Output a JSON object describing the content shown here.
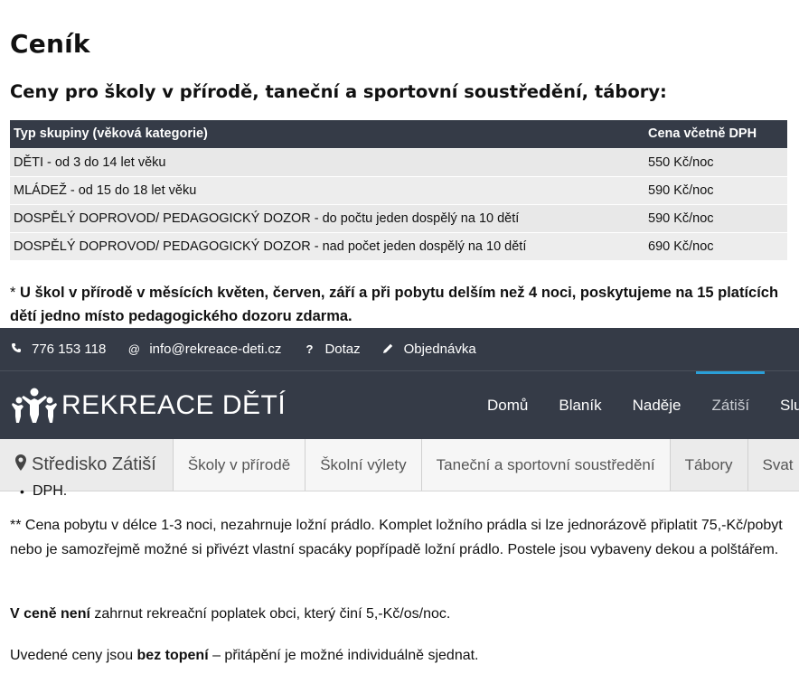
{
  "page": {
    "title": "Ceník",
    "subtitle": "Ceny pro školy v přírodě, taneční a sportovní soustředění, tábory:"
  },
  "price_table": {
    "headers": [
      "Typ skupiny (věková kategorie)",
      "Cena včetně DPH"
    ],
    "rows": [
      {
        "group": "DĚTI - od 3 do 14 let věku",
        "price": "550 Kč/noc"
      },
      {
        "group": "MLÁDEŽ - od 15 do 18 let věku",
        "price": "590 Kč/noc"
      },
      {
        "group": "DOSPĚLÝ DOPROVOD/ PEDAGOGICKÝ DOZOR - do počtu jeden dospělý na 10 dětí",
        "price": "590 Kč/noc"
      },
      {
        "group": "DOSPĚLÝ DOPROVOD/ PEDAGOGICKÝ DOZOR - nad počet jeden dospělý na 10 dětí",
        "price": "690 Kč/noc"
      }
    ]
  },
  "note1": {
    "prefix": "* ",
    "bold": "U škol v přírodě v měsících květen, červen, září a při pobytu delším než 4 noci, poskytujeme na 15 platících dětí jedno místo pedagogického dozoru zdarma."
  },
  "topbar": {
    "phone": "776 153 118",
    "email": "info@rekreace-deti.cz",
    "question": "Dotaz",
    "order": "Objednávka"
  },
  "navbar": {
    "logo_text": "REKREACE DĚTÍ",
    "items": [
      "Domů",
      "Blaník",
      "Naděje",
      "Zátiší",
      "Služ"
    ],
    "active_index": 3
  },
  "subnav": {
    "center_label": "Středisko Zátiší",
    "items": [
      "Školy v přírodě",
      "Školní výlety",
      "Taneční a sportovní soustředění",
      "Tábory",
      "Svat"
    ]
  },
  "below": {
    "bullet_fragment": "DPH.",
    "note2": "** Cena pobytu v délce  1-3 noci, nezahrnuje ložní prádlo. Komplet ložního prádla si lze jednorázově připlatit 75,-Kč/pobyt nebo je samozřejmě možné si přivézt vlastní spacáky popřípadě ložní prádlo. Postele jsou vybaveny dekou a polštářem.",
    "note3_bold": "V ceně není",
    "note3_rest": " zahrnut rekreační poplatek obci, který činí 5,-Kč/os/noc.",
    "note4_pre": "Uvedené ceny jsou ",
    "note4_bold": "bez topení",
    "note4_post": " – přitápění je možné individuálně sjednat."
  },
  "colors": {
    "dark_header": "#353b47",
    "accent": "#2a9fd8",
    "row_bg": "#e8e8e8"
  }
}
